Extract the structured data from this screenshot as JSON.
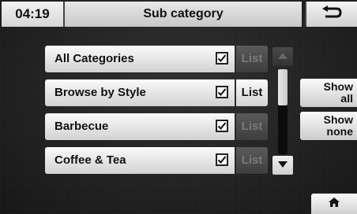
{
  "header": {
    "clock": "04:19",
    "title": "Sub category",
    "back_icon": "return-arrow-icon"
  },
  "categories": [
    {
      "label": "All Categories",
      "checked": true,
      "list_label": "List",
      "list_enabled": false
    },
    {
      "label": "Browse by Style",
      "checked": true,
      "list_label": "List",
      "list_enabled": true
    },
    {
      "label": "Barbecue",
      "checked": true,
      "list_label": "List",
      "list_enabled": false
    },
    {
      "label": "Coffee & Tea",
      "checked": true,
      "list_label": "List",
      "list_enabled": false
    }
  ],
  "scrollbar": {
    "up_enabled": false,
    "down_enabled": true,
    "position": 0
  },
  "side": {
    "show_all_line1": "Show",
    "show_all_line2": "all",
    "show_none_line1": "Show",
    "show_none_line2": "none",
    "home_icon": "home-icon"
  },
  "colors": {
    "background": "#1a1a1a",
    "button_light": "#e6e6e6",
    "button_disabled": "#4a4a4a",
    "disabled_text": "#7a7a7a"
  }
}
